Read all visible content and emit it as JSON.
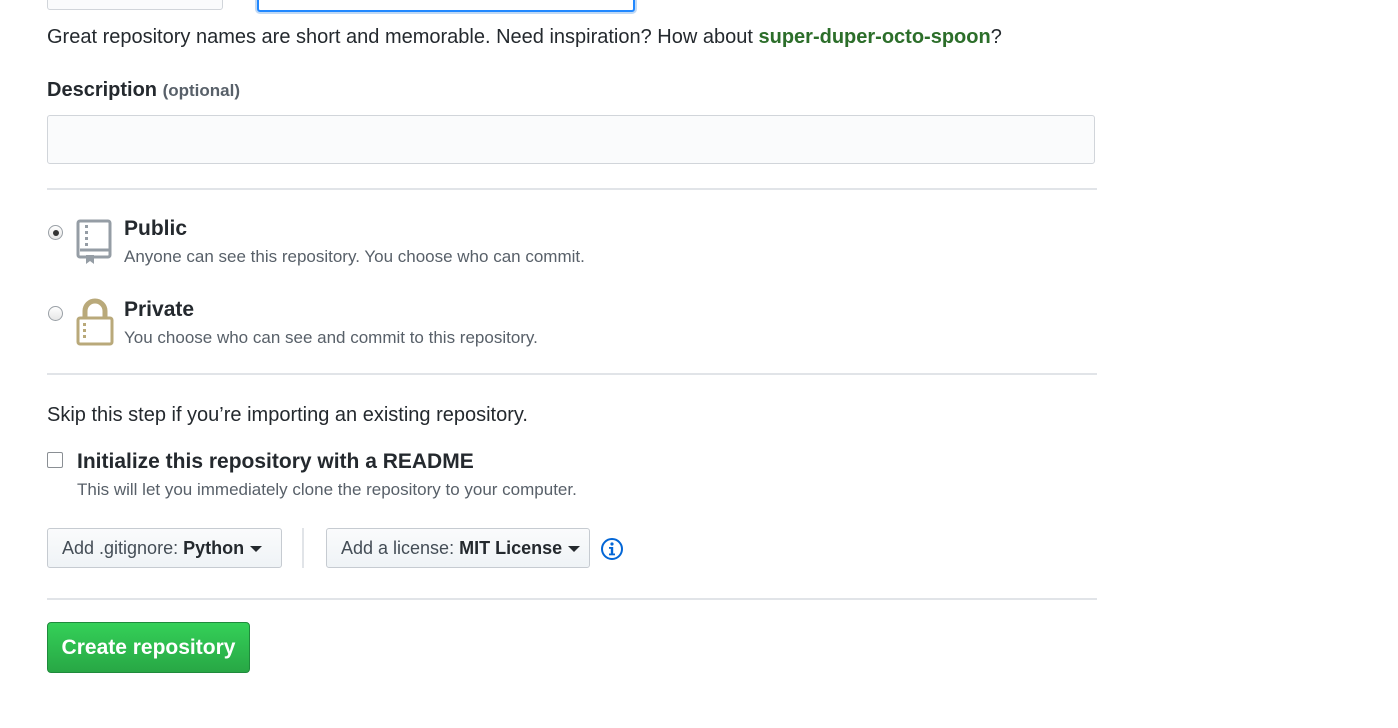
{
  "name_hint": {
    "text": "Great repository names are short and memorable. Need inspiration? How about ",
    "suggestion": "super-duper-octo-spoon",
    "suffix": "?"
  },
  "description": {
    "label": "Description",
    "optional": "(optional)",
    "value": "",
    "placeholder": ""
  },
  "visibility": {
    "public": {
      "title": "Public",
      "desc": "Anyone can see this repository. You choose who can commit.",
      "selected": true,
      "icon": "repo-book-icon"
    },
    "private": {
      "title": "Private",
      "desc": "You choose who can see and commit to this repository.",
      "selected": false,
      "icon": "lock-icon"
    }
  },
  "init": {
    "skip_text": "Skip this step if you’re importing an existing repository.",
    "readme_title": "Initialize this repository with a README",
    "readme_desc": "This will let you immediately clone the repository to your computer.",
    "readme_checked": false
  },
  "gitignore": {
    "label": "Add .gitignore: ",
    "value": "Python"
  },
  "license": {
    "label": "Add a license: ",
    "value": "MIT License",
    "info_icon": "info-icon"
  },
  "submit": {
    "label": "Create repository"
  },
  "colors": {
    "accent_green": "#28a745",
    "suggestion": "#2c6e2a",
    "info_blue": "#0366d6",
    "focus_blue": "#2188ff"
  }
}
